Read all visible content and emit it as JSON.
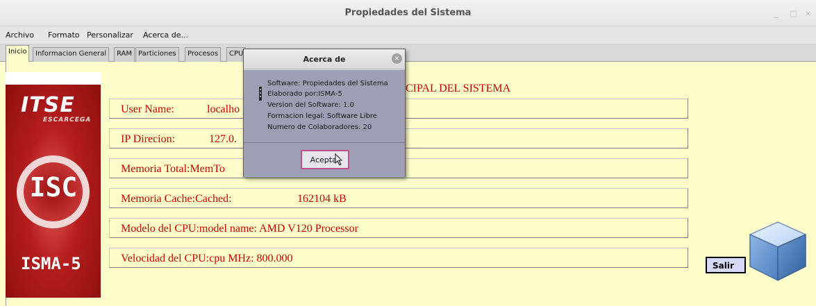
{
  "window": {
    "title": "Propiedades del Sistema",
    "controls": [
      "_",
      "□",
      "×"
    ]
  },
  "menu": [
    "Archivo",
    "Formato",
    "Personalizar",
    "Acerca de..."
  ],
  "tabs": [
    "Inicio",
    "Informacion General",
    "RAM",
    "Particiones",
    "Procesos",
    "CPU"
  ],
  "logo": {
    "brand": "ITSE",
    "sub": "ESCARCEGA",
    "isc": "ISC",
    "isma": "ISMA-5"
  },
  "main": {
    "heading": "CIPAL DEL SISTEMA",
    "fields": [
      {
        "label": "User Name:",
        "value": "localho"
      },
      {
        "label": "IP Direcion:",
        "value": "127.0."
      },
      {
        "label": "Memoria Total:MemTo",
        "value": ""
      },
      {
        "label": "Memoria Cache:Cached:",
        "value": "162104 kB"
      },
      {
        "label": "Modelo del CPU:model name: AMD V120 Processor",
        "value": ""
      },
      {
        "label": "Velocidad del CPU:cpu MHz: 800.000",
        "value": ""
      }
    ],
    "salir": "Salir"
  },
  "dialog": {
    "title": "Acerca de",
    "close": "×",
    "lines": [
      "Software: Propiedades del Sistema",
      "Elaborado por:ISMA-5",
      "Version del Software: 1.0",
      "Formacion legal: Software Libre",
      "Numero de Colaboradores: 20"
    ],
    "ok": "Aceptar"
  }
}
